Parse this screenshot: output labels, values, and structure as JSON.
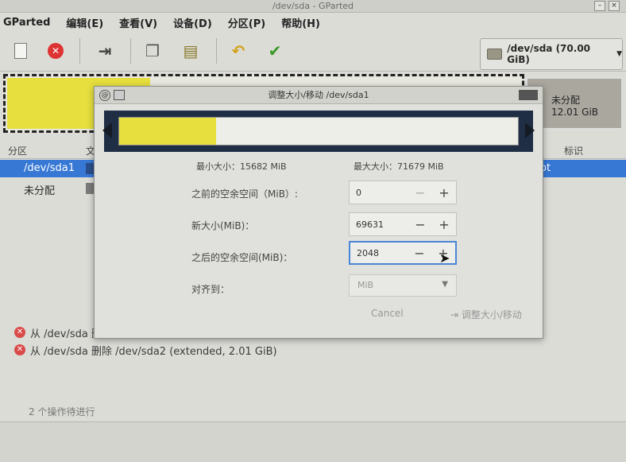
{
  "window": {
    "title": "/dev/sda - GParted"
  },
  "menu": {
    "items": [
      "GParted",
      "编辑(E)",
      "查看(V)",
      "设备(D)",
      "分区(P)",
      "帮助(H)"
    ]
  },
  "device": {
    "label": "/dev/sda (70.00 GiB)"
  },
  "graph": {
    "unallocated_label": "未分配",
    "unallocated_size": "12.01 GiB"
  },
  "list": {
    "headers": {
      "partition": "分区",
      "fs": "文",
      "flags": "标识"
    },
    "rows": [
      {
        "partition": "/dev/sda1",
        "tail": "ot"
      },
      {
        "partition": "未分配",
        "tail": ""
      }
    ]
  },
  "operations": [
    "从 /dev/sda 删",
    "从 /dev/sda 删除 /dev/sda2 (extended, 2.01 GiB)"
  ],
  "status": {
    "pending": "2 个操作待进行"
  },
  "dialog": {
    "title": "调整大小/移动 /dev/sda1",
    "min_size": "最小大小：15682 MiB",
    "max_size": "最大大小：71679 MiB",
    "free_before_label": "之前的空余空间（MiB）:",
    "free_before_value": "0",
    "new_size_label": "新大小(MiB)：",
    "new_size_value": "69631",
    "free_after_label": "之后的空余空间(MiB)：",
    "free_after_value": "2048",
    "align_label": "对齐到：",
    "align_value": "MiB",
    "cancel_label": "Cancel",
    "resize_label": "调整大小/移动"
  }
}
